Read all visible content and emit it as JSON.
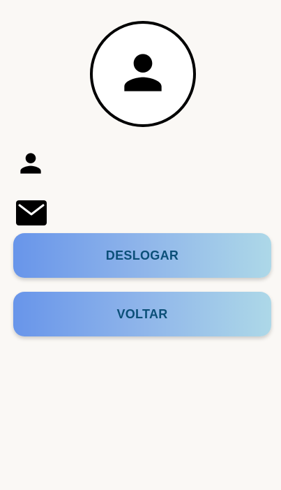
{
  "profile": {
    "avatar_icon": "person-icon",
    "name": "",
    "email": "",
    "name_icon": "person-icon",
    "email_icon": "mail-icon"
  },
  "actions": {
    "logout_label": "DESLOGAR",
    "back_label": "VOLTAR"
  },
  "colors": {
    "background": "#faf8f5",
    "button_gradient_start": "#6895ea",
    "button_gradient_end": "#add8e8",
    "button_text": "#0b4f78"
  }
}
